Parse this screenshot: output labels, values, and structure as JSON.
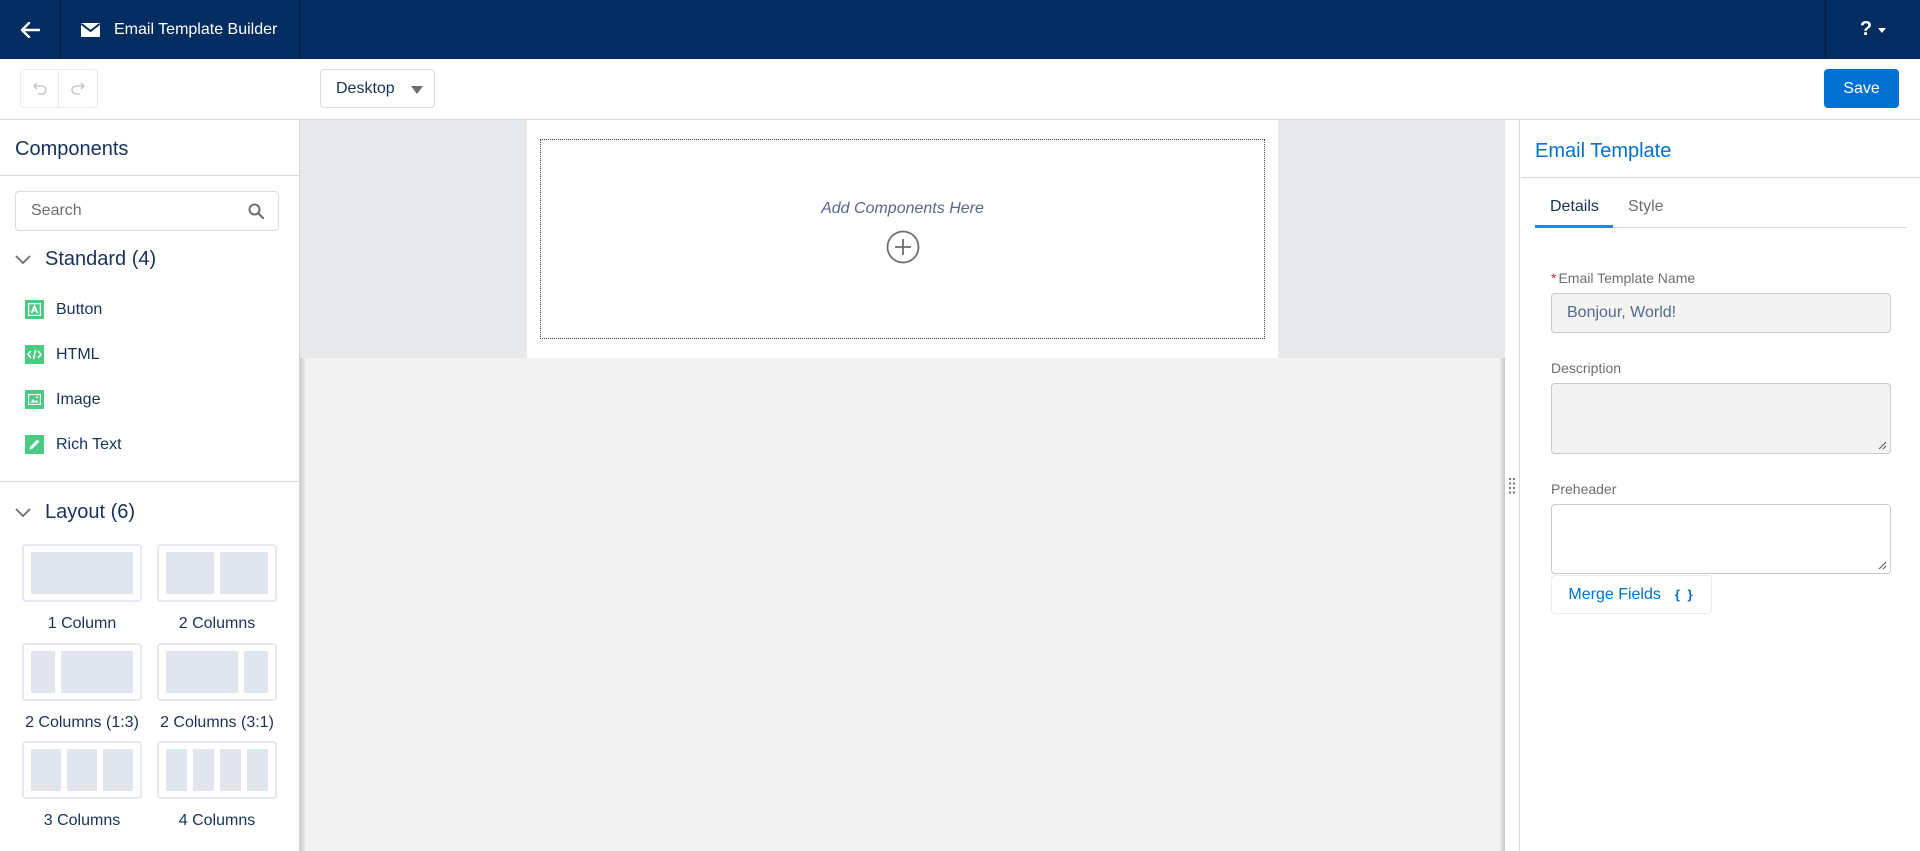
{
  "header": {
    "title": "Email Template Builder",
    "help_label": "?"
  },
  "toolbar": {
    "device": "Desktop",
    "save_label": "Save"
  },
  "components": {
    "title": "Components",
    "search_placeholder": "Search",
    "standard": {
      "label": "Standard (4)",
      "items": [
        {
          "label": "Button",
          "icon": "button-icon"
        },
        {
          "label": "HTML",
          "icon": "code-icon"
        },
        {
          "label": "Image",
          "icon": "image-icon"
        },
        {
          "label": "Rich Text",
          "icon": "pencil-icon"
        }
      ]
    },
    "layout": {
      "label": "Layout (6)",
      "items": [
        {
          "label": "1 Column"
        },
        {
          "label": "2 Columns"
        },
        {
          "label": "2 Columns (1:3)"
        },
        {
          "label": "2 Columns (3:1)"
        },
        {
          "label": "3 Columns"
        },
        {
          "label": "4 Columns"
        }
      ]
    }
  },
  "canvas": {
    "dropzone_text": "Add Components Here"
  },
  "properties": {
    "title": "Email Template",
    "tabs": [
      {
        "label": "Details",
        "active": true
      },
      {
        "label": "Style",
        "active": false
      }
    ],
    "fields": {
      "name_label": "Email Template Name",
      "name_required": "*",
      "name_value": "Bonjour, World!",
      "description_label": "Description",
      "description_value": "",
      "preheader_label": "Preheader",
      "preheader_value": ""
    },
    "merge_fields_label": "Merge Fields",
    "merge_fields_icon": "{ }"
  },
  "colors": {
    "nav": "#032d60",
    "brand": "#0070d2",
    "component_icon": "#4bca81",
    "active_tab": "#1589ee"
  }
}
